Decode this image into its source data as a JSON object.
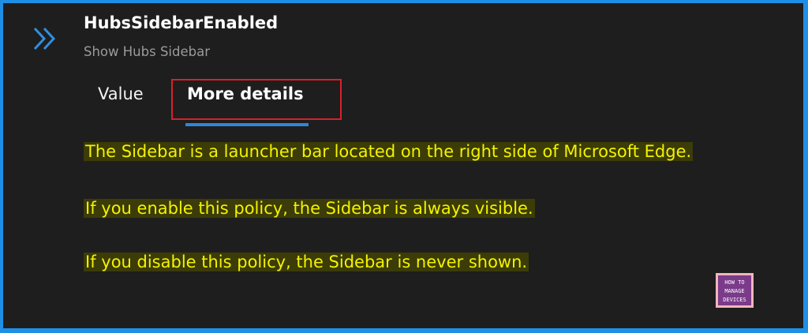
{
  "header": {
    "title": "HubsSidebarEnabled",
    "subtitle": "Show Hubs Sidebar",
    "expand_icon": "double-chevron-right-icon"
  },
  "tabs": [
    {
      "label": "Value",
      "selected": false
    },
    {
      "label": "More details",
      "selected": true
    }
  ],
  "details": {
    "lines": [
      "The Sidebar is a launcher bar located on the right side of Microsoft Edge.",
      "If you enable this policy, the Sidebar is always visible.",
      "If you disable this policy, the Sidebar is never shown."
    ]
  },
  "watermark": {
    "text_lines": [
      "HOW TO",
      "MANAGE",
      "DEVICES"
    ]
  },
  "colors": {
    "page_background": "#1e1e1e",
    "outer_border": "#1f8fe6",
    "highlight_text": "#f4f200",
    "callout_red": "#d8202a",
    "tab_underline": "#2f86d6"
  }
}
